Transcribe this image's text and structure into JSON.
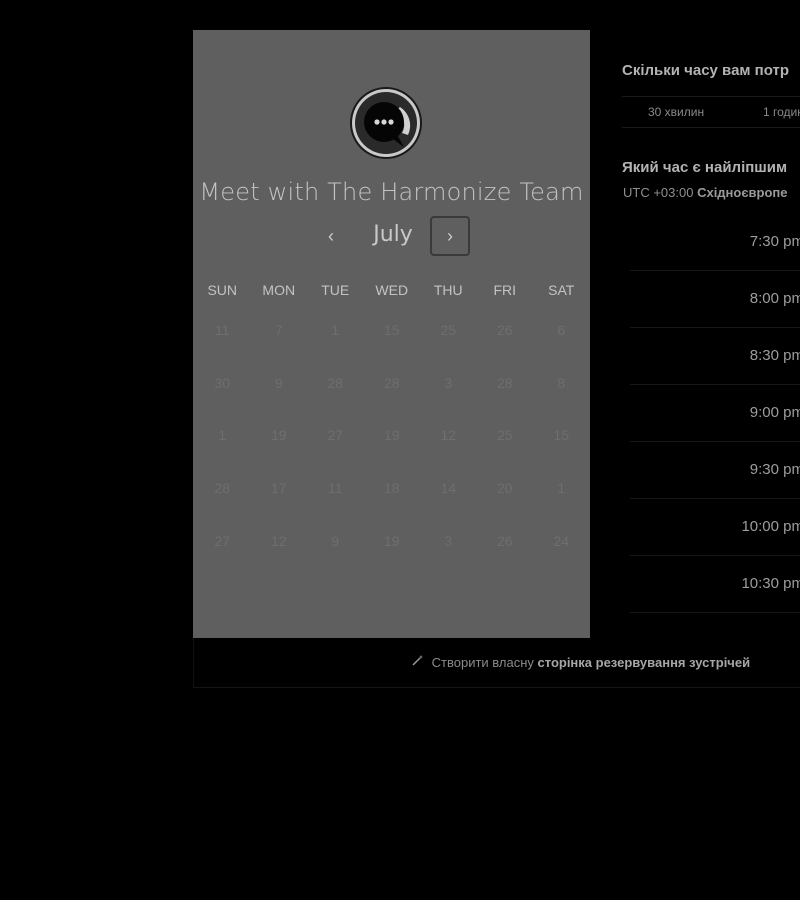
{
  "booking": {
    "title": "Meet with The Harmonize Team",
    "month": "July",
    "prev_icon": "‹",
    "next_icon": "›",
    "weekdays": [
      "SUN",
      "MON",
      "TUE",
      "WED",
      "THU",
      "FRI",
      "SAT"
    ],
    "weeks": [
      [
        "11",
        "7",
        "1",
        "15",
        "25",
        "26",
        "6"
      ],
      [
        "30",
        "9",
        "28",
        "28",
        "3",
        "28",
        "8"
      ],
      [
        "1",
        "19",
        "27",
        "19",
        "12",
        "25",
        "15"
      ],
      [
        "28",
        "17",
        "11",
        "18",
        "14",
        "20",
        "1"
      ],
      [
        "27",
        "12",
        "9",
        "19",
        "3",
        "26",
        "24"
      ]
    ]
  },
  "scheduler": {
    "duration_question": "Скільки часу вам потр",
    "durations": [
      "30 хвилин",
      "1 годин"
    ],
    "time_question": "Який час є найліпшим",
    "timezone_prefix": "UTC +03:00",
    "timezone_name": "Східноєвропе",
    "slots": [
      "7:30 pm",
      "8:00 pm",
      "8:30 pm",
      "9:00 pm",
      "9:30 pm",
      "10:00 pm",
      "10:30 pm"
    ]
  },
  "footer": {
    "prefix": "Створити власну",
    "link": "сторінка резервування зустрічей"
  },
  "colors": {
    "panel": "#5f5f5f",
    "background": "#000000"
  }
}
